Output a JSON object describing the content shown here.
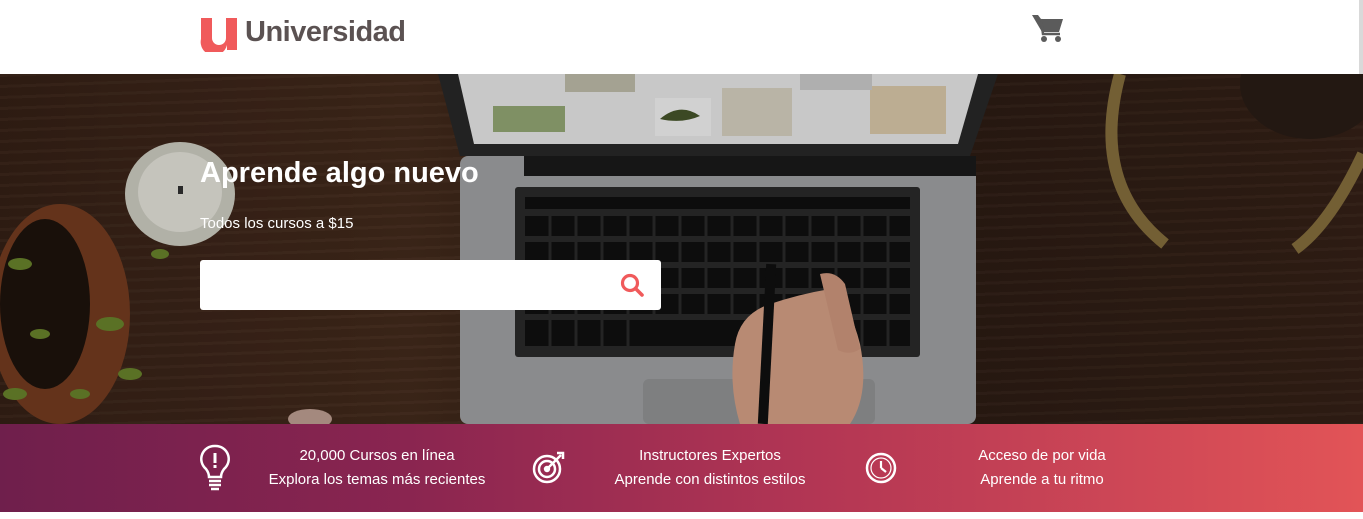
{
  "header": {
    "logo_text": "Universidad",
    "logo_mark_letter": "u",
    "cart_icon": "shopping-cart-icon",
    "brand_color": "#f05a5b"
  },
  "hero": {
    "title": "Aprende algo nuevo",
    "subtitle": "Todos los cursos a $15",
    "search": {
      "value": "",
      "placeholder": ""
    },
    "search_icon": "search-icon"
  },
  "features": [
    {
      "icon": "lightbulb-icon",
      "line1": "20,000 Cursos en línea",
      "line2": "Explora los temas más recientes"
    },
    {
      "icon": "target-icon",
      "line1": "Instructores Expertos",
      "line2": "Aprende con distintos estilos"
    },
    {
      "icon": "clock-icon",
      "line1": "Acceso de por vida",
      "line2": "Aprende a tu ritmo"
    }
  ],
  "colors": {
    "band_start": "#6f1f4c",
    "band_end": "#e25457",
    "logo_text": "#5b5252",
    "cart": "#5b5b5b"
  }
}
